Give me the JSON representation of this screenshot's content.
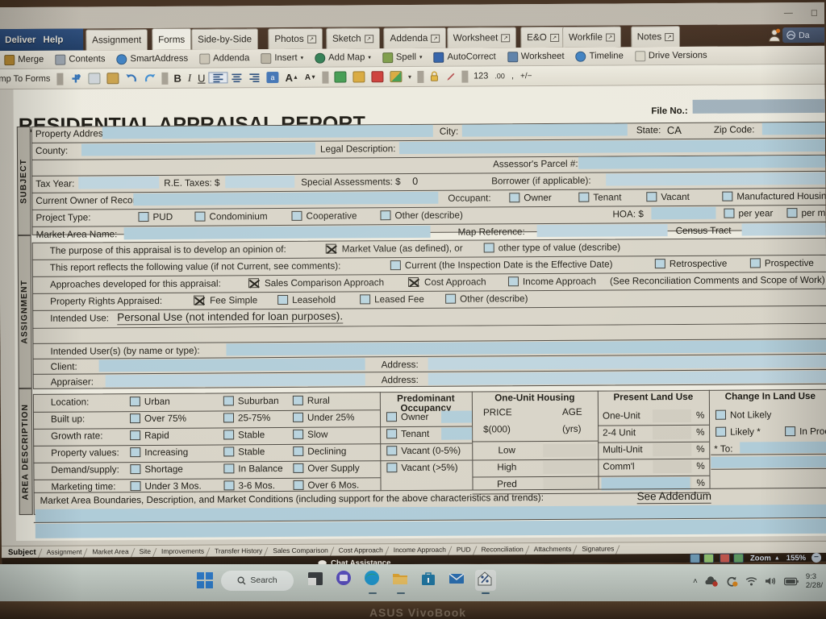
{
  "window": {
    "minimize": "—",
    "restore": "◻"
  },
  "app_tabs": {
    "deliver": "Deliver",
    "help": "Help",
    "items": [
      {
        "label": "Assignment",
        "popout": false,
        "selected": false
      },
      {
        "label": "Forms",
        "popout": false,
        "selected": true
      },
      {
        "label": "Side-by-Side",
        "popout": false,
        "selected": false
      },
      {
        "label": "Photos",
        "popout": true,
        "selected": false
      },
      {
        "label": "Sketch",
        "popout": true,
        "selected": false
      },
      {
        "label": "Addenda",
        "popout": true,
        "selected": false
      },
      {
        "label": "Worksheet",
        "popout": true,
        "selected": false
      },
      {
        "label": "E&O",
        "popout": true,
        "selected": false
      },
      {
        "label": "Workfile",
        "popout": true,
        "selected": false
      },
      {
        "label": "Notes",
        "popout": true,
        "selected": false
      }
    ],
    "account_badge": "Da"
  },
  "ribbon": {
    "items": [
      {
        "label": "Merge",
        "icon": "merge-icon",
        "color": "#b4872f"
      },
      {
        "label": "Contents",
        "icon": "contents-icon",
        "color": "#9aa3ad"
      },
      {
        "label": "SmartAddress",
        "icon": "smartaddress-icon",
        "color": "#3d7fc1"
      },
      {
        "label": "Addenda",
        "icon": "addenda-icon",
        "color": "#c9c3b4"
      },
      {
        "label": "Insert",
        "icon": "insert-icon",
        "color": "#b8b2a2",
        "caret": true
      },
      {
        "label": "Add Map",
        "icon": "add-map-icon",
        "color": "#2e7d52",
        "caret": true
      },
      {
        "label": "Spell",
        "icon": "spell-icon",
        "color": "#7b9b46",
        "caret": true
      },
      {
        "label": "AutoCorrect",
        "icon": "autocorrect-icon",
        "color": "#2f5fa8"
      },
      {
        "label": "Worksheet",
        "icon": "worksheet-icon",
        "color": "#5a7fa8"
      },
      {
        "label": "Timeline",
        "icon": "timeline-icon",
        "color": "#3d7fc1"
      },
      {
        "label": "Drive Versions",
        "icon": "drive-versions-icon",
        "color": "#d8d4c6"
      }
    ]
  },
  "format_bar": {
    "jump_to_forms": "mp To Forms",
    "bold": "B",
    "italic": "I",
    "underline": "U",
    "font_grow": "A",
    "font_shrink": "A",
    "number_123": "123",
    "decimal": ".00",
    "currency": ",",
    "plus_minus": "+/−"
  },
  "document": {
    "title": "RESIDENTIAL APPRAISAL REPORT",
    "file_no_label": "File No.:",
    "file_no_value": "",
    "rails": {
      "subject": "SUBJECT",
      "assignment": "ASSIGNMENT",
      "area_description": "AREA DESCRIPTION"
    },
    "subject": {
      "property_address_label": "Property Address:",
      "property_address_value": "",
      "city_label": "City:",
      "city_value": "",
      "state_label": "State:",
      "state_value": "CA",
      "zip_label": "Zip Code:",
      "zip_value": "",
      "county_label": "County:",
      "county_value": "",
      "legal_description_label": "Legal Description:",
      "legal_description_value": "",
      "assessors_parcel_label": "Assessor's Parcel #:",
      "assessors_parcel_value": "",
      "tax_year_label": "Tax Year:",
      "tax_year_value": "",
      "re_taxes_label": "R.E. Taxes: $",
      "re_taxes_value": "",
      "special_assessments_label": "Special Assessments: $",
      "special_assessments_value": "0",
      "borrower_label": "Borrower (if applicable):",
      "borrower_value": "",
      "current_owner_label": "Current Owner of Record:",
      "current_owner_value": "",
      "occupant_label": "Occupant:",
      "occupant_options": [
        "Owner",
        "Tenant",
        "Vacant"
      ],
      "manufactured_housing": "Manufactured Housing",
      "project_type_label": "Project Type:",
      "project_type_options": [
        "PUD",
        "Condominium",
        "Cooperative",
        "Other (describe)"
      ],
      "hoa_label": "HOA: $",
      "hoa_value": "",
      "hoa_per_year": "per year",
      "hoa_per_month": "per mon",
      "market_area_name_label": "Market Area Name:",
      "market_area_name_value": "",
      "map_reference_label": "Map Reference:",
      "map_reference_value": "",
      "census_tract_label": "Census Tract",
      "census_tract_value": ""
    },
    "assignment": {
      "purpose_label": "The purpose of this appraisal is to develop an opinion of:",
      "purpose_market_value": "Market Value (as defined), or",
      "purpose_market_value_checked": true,
      "purpose_other": "other type of value (describe)",
      "purpose_other_checked": false,
      "reflects_label": "This report reflects the following value (if not Current, see comments):",
      "reflects_current": "Current (the Inspection Date is the Effective Date)",
      "reflects_retrospective": "Retrospective",
      "reflects_prospective": "Prospective",
      "approaches_label": "Approaches developed for this appraisal:",
      "approach_sales": "Sales Comparison Approach",
      "approach_sales_checked": true,
      "approach_cost": "Cost Approach",
      "approach_cost_checked": true,
      "approach_income": "Income Approach",
      "approach_income_checked": false,
      "approaches_note": "(See Reconciliation Comments and Scope of Work)",
      "rights_label": "Property Rights Appraised:",
      "rights_fee_simple": "Fee Simple",
      "rights_fee_simple_checked": true,
      "rights_leasehold": "Leasehold",
      "rights_leased_fee": "Leased Fee",
      "rights_other": "Other (describe)",
      "intended_use_label": "Intended Use:",
      "intended_use_value": "Personal Use (not intended for loan purposes).",
      "intended_users_label": "Intended User(s) (by name or type):",
      "intended_users_value": "",
      "client_label": "Client:",
      "client_value": "",
      "client_address_label": "Address:",
      "client_address_value": "",
      "appraiser_label": "Appraiser:",
      "appraiser_value": "",
      "appraiser_address_label": "Address:",
      "appraiser_address_value": ""
    },
    "area_description": {
      "rows": [
        {
          "label": "Location:",
          "opts": [
            "Urban",
            "Suburban",
            "Rural"
          ]
        },
        {
          "label": "Built up:",
          "opts": [
            "Over 75%",
            "25-75%",
            "Under 25%"
          ]
        },
        {
          "label": "Growth rate:",
          "opts": [
            "Rapid",
            "Stable",
            "Slow"
          ]
        },
        {
          "label": "Property values:",
          "opts": [
            "Increasing",
            "Stable",
            "Declining"
          ]
        },
        {
          "label": "Demand/supply:",
          "opts": [
            "Shortage",
            "In Balance",
            "Over Supply"
          ]
        },
        {
          "label": "Marketing time:",
          "opts": [
            "Under 3 Mos.",
            "3-6 Mos.",
            "Over 6 Mos."
          ]
        }
      ],
      "predominant_occupancy_title_1": "Predominant",
      "predominant_occupancy_title_2": "Occupancy",
      "occupancy_rows": [
        "Owner",
        "Tenant",
        "Vacant (0-5%)",
        "Vacant (>5%)"
      ],
      "one_unit_housing_title": "One-Unit Housing",
      "one_unit_price": "PRICE",
      "one_unit_age": "AGE",
      "one_unit_price_units": "$(000)",
      "one_unit_age_units": "(yrs)",
      "one_unit_rows": [
        "Low",
        "High",
        "Pred"
      ],
      "present_land_use_title": "Present Land Use",
      "land_use_rows": [
        "One-Unit",
        "2-4 Unit",
        "Multi-Unit",
        "Comm'l",
        ""
      ],
      "percent_symbol": "%",
      "change_land_use_title": "Change In Land Use",
      "change_not_likely": "Not Likely",
      "change_likely": "Likely *",
      "change_in_process": "In Proces",
      "change_to_label": "* To:",
      "change_to_value": "",
      "boundaries_label": "Market Area Boundaries, Description, and Market Conditions (including support for the above characteristics and trends):",
      "boundaries_value": "See Addendum"
    }
  },
  "form_tabs": {
    "items": [
      {
        "label": "Subject",
        "selected": true
      },
      {
        "label": "Assignment",
        "selected": false
      },
      {
        "label": "Market Area",
        "selected": false
      },
      {
        "label": "Site",
        "selected": false
      },
      {
        "label": "Improvements",
        "selected": false
      },
      {
        "label": "Transfer History",
        "selected": false
      },
      {
        "label": "Sales Comparison",
        "selected": false
      },
      {
        "label": "Cost Approach",
        "selected": false
      },
      {
        "label": "Income Approach",
        "selected": false
      },
      {
        "label": "PUD",
        "selected": false
      },
      {
        "label": "Reconciliation",
        "selected": false
      },
      {
        "label": "Attachments",
        "selected": false
      },
      {
        "label": "Signatures",
        "selected": false
      }
    ]
  },
  "status_bar": {
    "chat_assistance": "Chat Assistance",
    "zoom_label": "Zoom",
    "zoom_caret": "▲",
    "zoom_value": "155%",
    "zoom_out": "−"
  },
  "taskbar": {
    "start": "start-icon",
    "search_label": "Search",
    "icons": [
      "file-explorer-icon",
      "chat-teams-icon",
      "edge-browser-icon",
      "folder-icon",
      "store-icon",
      "mail-icon",
      "appraisal-app-icon"
    ],
    "tray": [
      "chevron-up-icon",
      "onedrive-alert-icon",
      "sync-alert-icon",
      "wifi-icon",
      "volume-icon",
      "battery-icon"
    ],
    "clock_time": "9:3",
    "clock_date": "2/28/"
  },
  "laptop": {
    "brand": "ASUS VivoBook"
  },
  "colors": {
    "field_blue": "#aecbd8",
    "field_blue_light": "#bcd3de",
    "paper": "#eceadf",
    "rail_gray": "#bcb8ac",
    "accent_blue": "#2d4f80"
  }
}
